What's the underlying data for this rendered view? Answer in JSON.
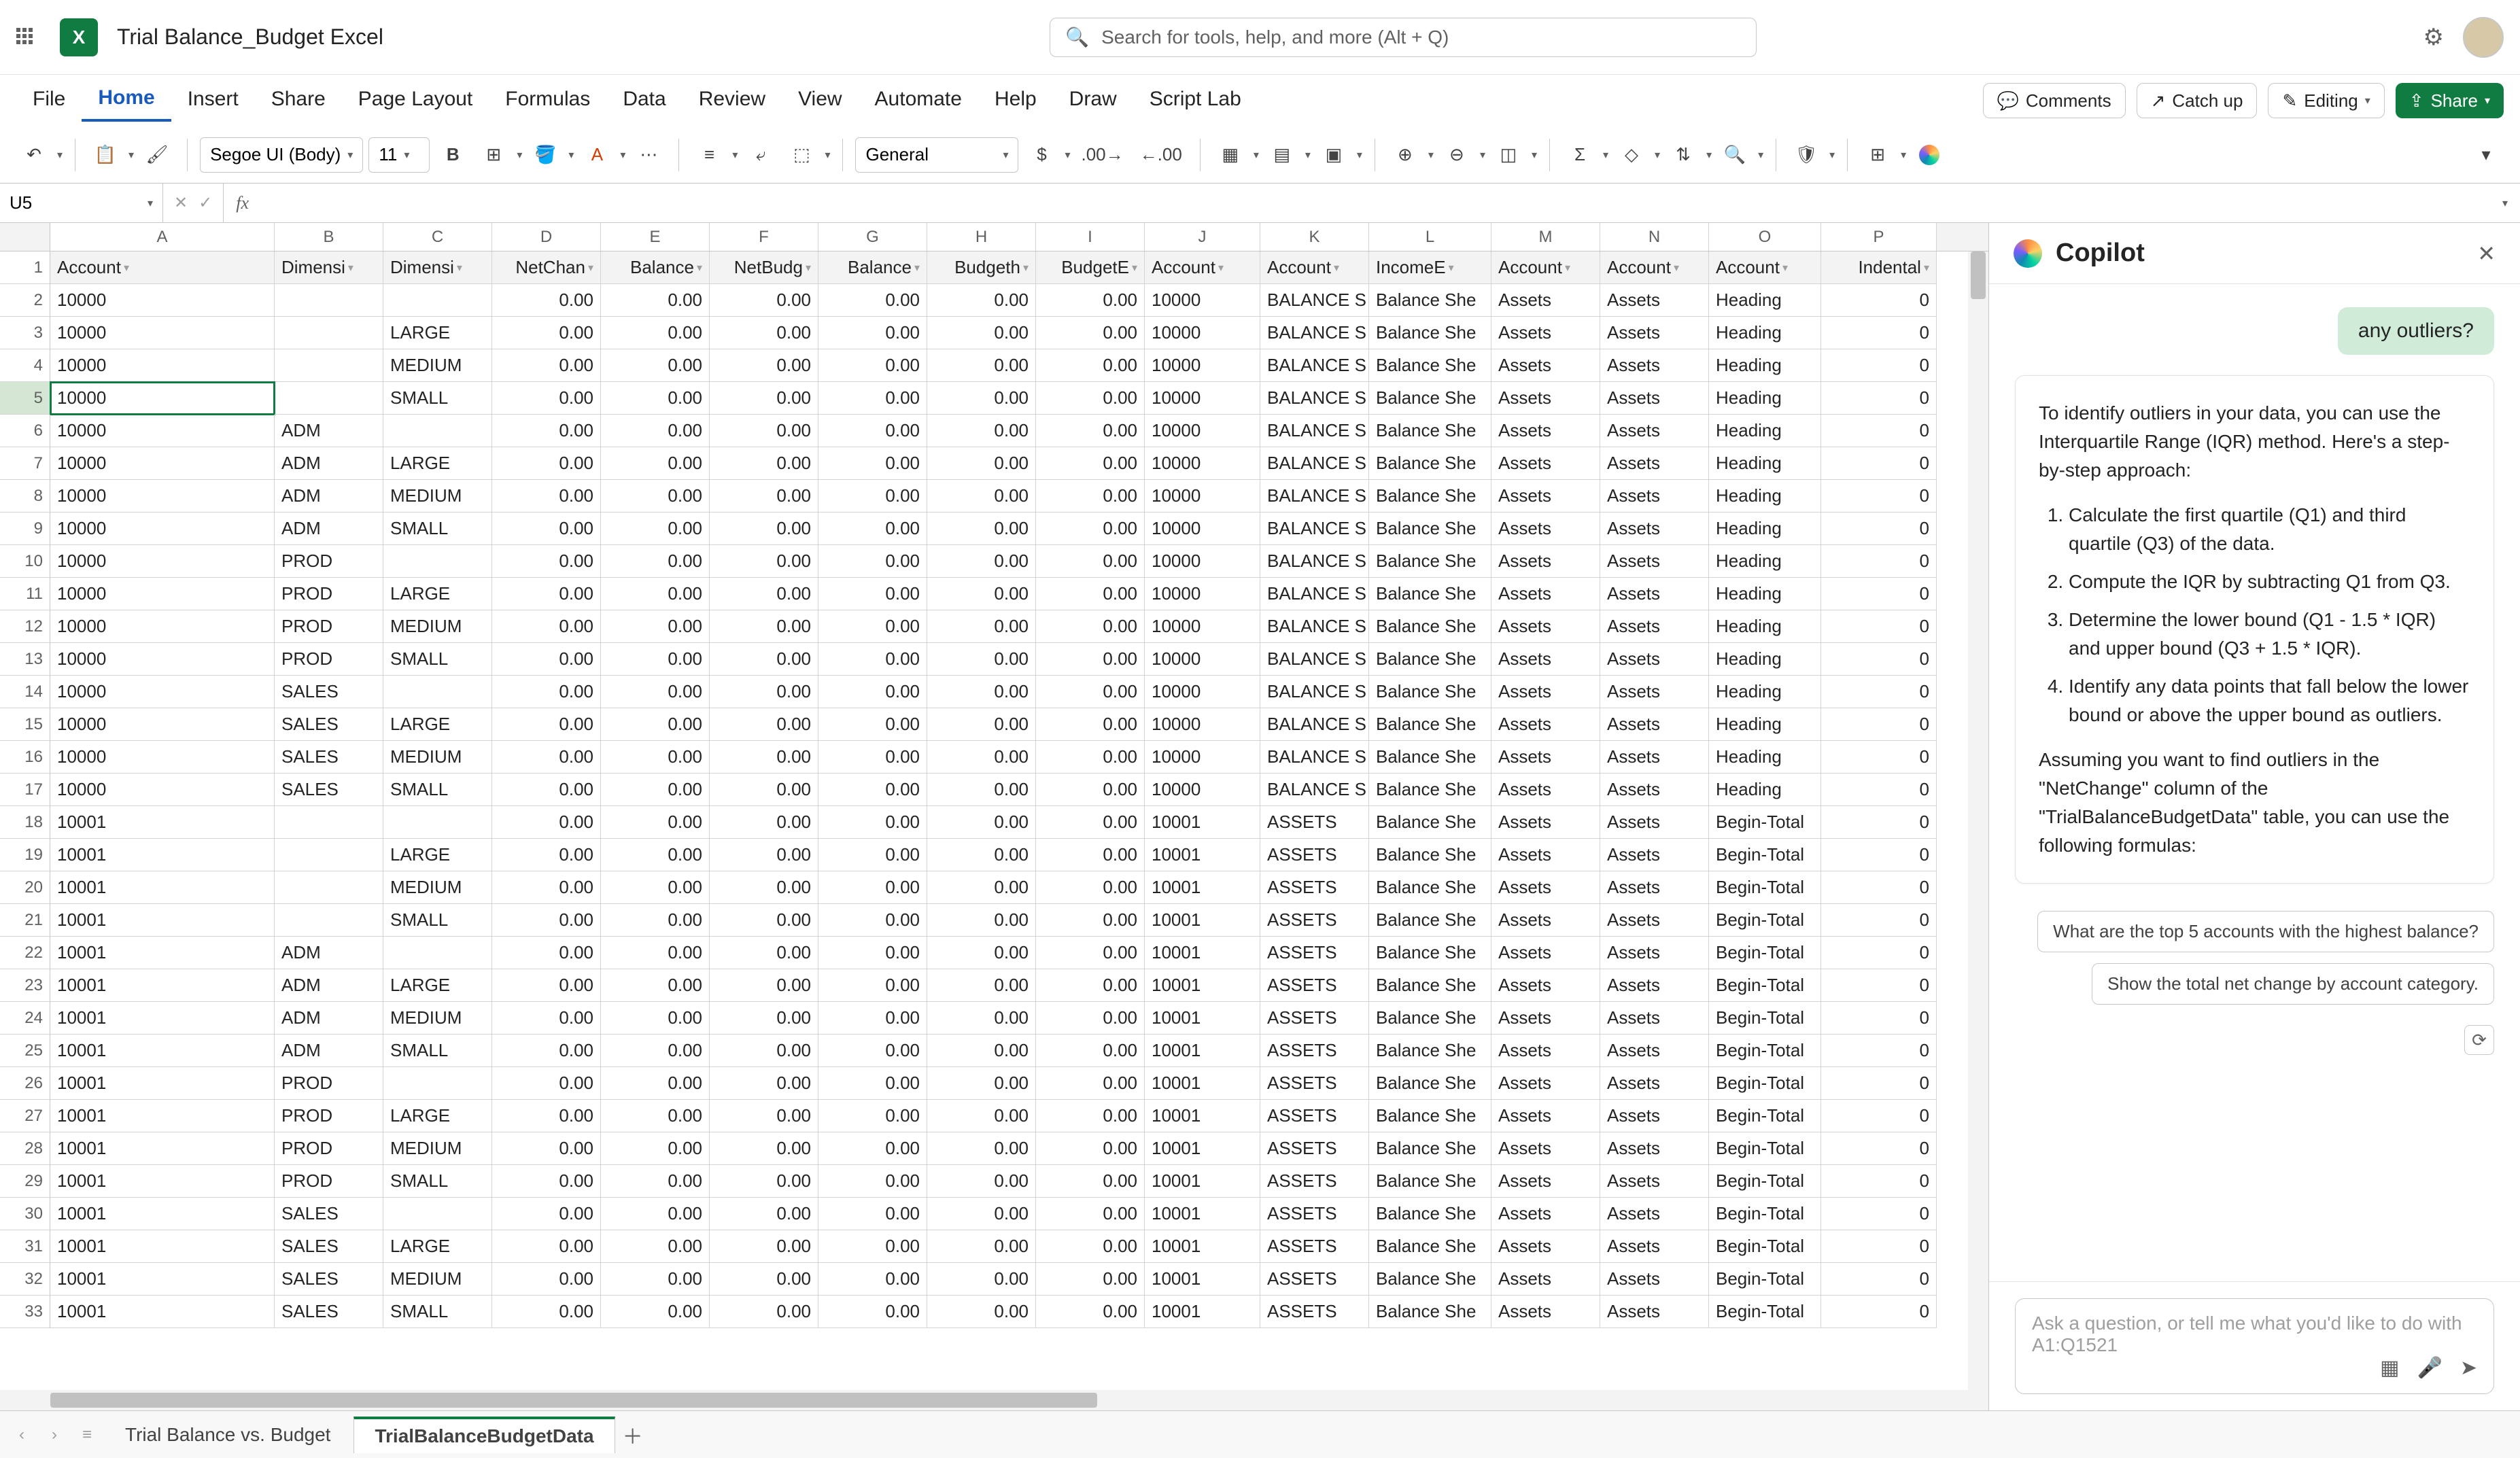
{
  "docTitle": "Trial Balance_Budget Excel",
  "searchPlaceholder": "Search for tools, help, and more (Alt + Q)",
  "menu": [
    "File",
    "Home",
    "Insert",
    "Share",
    "Page Layout",
    "Formulas",
    "Data",
    "Review",
    "View",
    "Automate",
    "Help",
    "Draw",
    "Script Lab"
  ],
  "menuActive": "Home",
  "pills": {
    "comments": "Comments",
    "catchup": "Catch up",
    "editing": "Editing",
    "share": "Share"
  },
  "fontName": "Segoe UI (Body)",
  "fontSize": "11",
  "numberFormat": "General",
  "nameBox": "U5",
  "cols": [
    "A",
    "B",
    "C",
    "D",
    "E",
    "F",
    "G",
    "H",
    "I",
    "J",
    "K",
    "L",
    "M",
    "N",
    "O",
    "P"
  ],
  "colWidths": [
    "cw-A",
    "cw-B",
    "cw-C",
    "cw-D",
    "cw-E",
    "cw-F",
    "cw-G",
    "cw-H",
    "cw-I",
    "cw-J",
    "cw-K",
    "cw-L",
    "cw-M",
    "cw-N",
    "cw-O",
    "cw-P"
  ],
  "headerRow": [
    "Account",
    "Dimensi",
    "Dimensi",
    "NetChan",
    "Balance",
    "NetBudg",
    "Balance",
    "Budgeth",
    "BudgetE",
    "Account",
    "Account",
    "IncomeE",
    "Account",
    "Account",
    "Account",
    "Indental"
  ],
  "rows": [
    [
      "10000",
      "",
      "",
      "0.00",
      "0.00",
      "0.00",
      "0.00",
      "0.00",
      "0.00",
      "10000",
      "BALANCE S",
      "Balance She",
      "Assets",
      "Assets",
      "Heading",
      "0"
    ],
    [
      "10000",
      "",
      "LARGE",
      "0.00",
      "0.00",
      "0.00",
      "0.00",
      "0.00",
      "0.00",
      "10000",
      "BALANCE S",
      "Balance She",
      "Assets",
      "Assets",
      "Heading",
      "0"
    ],
    [
      "10000",
      "",
      "MEDIUM",
      "0.00",
      "0.00",
      "0.00",
      "0.00",
      "0.00",
      "0.00",
      "10000",
      "BALANCE S",
      "Balance She",
      "Assets",
      "Assets",
      "Heading",
      "0"
    ],
    [
      "10000",
      "",
      "SMALL",
      "0.00",
      "0.00",
      "0.00",
      "0.00",
      "0.00",
      "0.00",
      "10000",
      "BALANCE S",
      "Balance She",
      "Assets",
      "Assets",
      "Heading",
      "0"
    ],
    [
      "10000",
      "ADM",
      "",
      "0.00",
      "0.00",
      "0.00",
      "0.00",
      "0.00",
      "0.00",
      "10000",
      "BALANCE S",
      "Balance She",
      "Assets",
      "Assets",
      "Heading",
      "0"
    ],
    [
      "10000",
      "ADM",
      "LARGE",
      "0.00",
      "0.00",
      "0.00",
      "0.00",
      "0.00",
      "0.00",
      "10000",
      "BALANCE S",
      "Balance She",
      "Assets",
      "Assets",
      "Heading",
      "0"
    ],
    [
      "10000",
      "ADM",
      "MEDIUM",
      "0.00",
      "0.00",
      "0.00",
      "0.00",
      "0.00",
      "0.00",
      "10000",
      "BALANCE S",
      "Balance She",
      "Assets",
      "Assets",
      "Heading",
      "0"
    ],
    [
      "10000",
      "ADM",
      "SMALL",
      "0.00",
      "0.00",
      "0.00",
      "0.00",
      "0.00",
      "0.00",
      "10000",
      "BALANCE S",
      "Balance She",
      "Assets",
      "Assets",
      "Heading",
      "0"
    ],
    [
      "10000",
      "PROD",
      "",
      "0.00",
      "0.00",
      "0.00",
      "0.00",
      "0.00",
      "0.00",
      "10000",
      "BALANCE S",
      "Balance She",
      "Assets",
      "Assets",
      "Heading",
      "0"
    ],
    [
      "10000",
      "PROD",
      "LARGE",
      "0.00",
      "0.00",
      "0.00",
      "0.00",
      "0.00",
      "0.00",
      "10000",
      "BALANCE S",
      "Balance She",
      "Assets",
      "Assets",
      "Heading",
      "0"
    ],
    [
      "10000",
      "PROD",
      "MEDIUM",
      "0.00",
      "0.00",
      "0.00",
      "0.00",
      "0.00",
      "0.00",
      "10000",
      "BALANCE S",
      "Balance She",
      "Assets",
      "Assets",
      "Heading",
      "0"
    ],
    [
      "10000",
      "PROD",
      "SMALL",
      "0.00",
      "0.00",
      "0.00",
      "0.00",
      "0.00",
      "0.00",
      "10000",
      "BALANCE S",
      "Balance She",
      "Assets",
      "Assets",
      "Heading",
      "0"
    ],
    [
      "10000",
      "SALES",
      "",
      "0.00",
      "0.00",
      "0.00",
      "0.00",
      "0.00",
      "0.00",
      "10000",
      "BALANCE S",
      "Balance She",
      "Assets",
      "Assets",
      "Heading",
      "0"
    ],
    [
      "10000",
      "SALES",
      "LARGE",
      "0.00",
      "0.00",
      "0.00",
      "0.00",
      "0.00",
      "0.00",
      "10000",
      "BALANCE S",
      "Balance She",
      "Assets",
      "Assets",
      "Heading",
      "0"
    ],
    [
      "10000",
      "SALES",
      "MEDIUM",
      "0.00",
      "0.00",
      "0.00",
      "0.00",
      "0.00",
      "0.00",
      "10000",
      "BALANCE S",
      "Balance She",
      "Assets",
      "Assets",
      "Heading",
      "0"
    ],
    [
      "10000",
      "SALES",
      "SMALL",
      "0.00",
      "0.00",
      "0.00",
      "0.00",
      "0.00",
      "0.00",
      "10000",
      "BALANCE S",
      "Balance She",
      "Assets",
      "Assets",
      "Heading",
      "0"
    ],
    [
      "10001",
      "",
      "",
      "0.00",
      "0.00",
      "0.00",
      "0.00",
      "0.00",
      "0.00",
      "10001",
      "ASSETS",
      "Balance She",
      "Assets",
      "Assets",
      "Begin-Total",
      "0"
    ],
    [
      "10001",
      "",
      "LARGE",
      "0.00",
      "0.00",
      "0.00",
      "0.00",
      "0.00",
      "0.00",
      "10001",
      "ASSETS",
      "Balance She",
      "Assets",
      "Assets",
      "Begin-Total",
      "0"
    ],
    [
      "10001",
      "",
      "MEDIUM",
      "0.00",
      "0.00",
      "0.00",
      "0.00",
      "0.00",
      "0.00",
      "10001",
      "ASSETS",
      "Balance She",
      "Assets",
      "Assets",
      "Begin-Total",
      "0"
    ],
    [
      "10001",
      "",
      "SMALL",
      "0.00",
      "0.00",
      "0.00",
      "0.00",
      "0.00",
      "0.00",
      "10001",
      "ASSETS",
      "Balance She",
      "Assets",
      "Assets",
      "Begin-Total",
      "0"
    ],
    [
      "10001",
      "ADM",
      "",
      "0.00",
      "0.00",
      "0.00",
      "0.00",
      "0.00",
      "0.00",
      "10001",
      "ASSETS",
      "Balance She",
      "Assets",
      "Assets",
      "Begin-Total",
      "0"
    ],
    [
      "10001",
      "ADM",
      "LARGE",
      "0.00",
      "0.00",
      "0.00",
      "0.00",
      "0.00",
      "0.00",
      "10001",
      "ASSETS",
      "Balance She",
      "Assets",
      "Assets",
      "Begin-Total",
      "0"
    ],
    [
      "10001",
      "ADM",
      "MEDIUM",
      "0.00",
      "0.00",
      "0.00",
      "0.00",
      "0.00",
      "0.00",
      "10001",
      "ASSETS",
      "Balance She",
      "Assets",
      "Assets",
      "Begin-Total",
      "0"
    ],
    [
      "10001",
      "ADM",
      "SMALL",
      "0.00",
      "0.00",
      "0.00",
      "0.00",
      "0.00",
      "0.00",
      "10001",
      "ASSETS",
      "Balance She",
      "Assets",
      "Assets",
      "Begin-Total",
      "0"
    ],
    [
      "10001",
      "PROD",
      "",
      "0.00",
      "0.00",
      "0.00",
      "0.00",
      "0.00",
      "0.00",
      "10001",
      "ASSETS",
      "Balance She",
      "Assets",
      "Assets",
      "Begin-Total",
      "0"
    ],
    [
      "10001",
      "PROD",
      "LARGE",
      "0.00",
      "0.00",
      "0.00",
      "0.00",
      "0.00",
      "0.00",
      "10001",
      "ASSETS",
      "Balance She",
      "Assets",
      "Assets",
      "Begin-Total",
      "0"
    ],
    [
      "10001",
      "PROD",
      "MEDIUM",
      "0.00",
      "0.00",
      "0.00",
      "0.00",
      "0.00",
      "0.00",
      "10001",
      "ASSETS",
      "Balance She",
      "Assets",
      "Assets",
      "Begin-Total",
      "0"
    ],
    [
      "10001",
      "PROD",
      "SMALL",
      "0.00",
      "0.00",
      "0.00",
      "0.00",
      "0.00",
      "0.00",
      "10001",
      "ASSETS",
      "Balance She",
      "Assets",
      "Assets",
      "Begin-Total",
      "0"
    ],
    [
      "10001",
      "SALES",
      "",
      "0.00",
      "0.00",
      "0.00",
      "0.00",
      "0.00",
      "0.00",
      "10001",
      "ASSETS",
      "Balance She",
      "Assets",
      "Assets",
      "Begin-Total",
      "0"
    ],
    [
      "10001",
      "SALES",
      "LARGE",
      "0.00",
      "0.00",
      "0.00",
      "0.00",
      "0.00",
      "0.00",
      "10001",
      "ASSETS",
      "Balance She",
      "Assets",
      "Assets",
      "Begin-Total",
      "0"
    ],
    [
      "10001",
      "SALES",
      "MEDIUM",
      "0.00",
      "0.00",
      "0.00",
      "0.00",
      "0.00",
      "0.00",
      "10001",
      "ASSETS",
      "Balance She",
      "Assets",
      "Assets",
      "Begin-Total",
      "0"
    ],
    [
      "10001",
      "SALES",
      "SMALL",
      "0.00",
      "0.00",
      "0.00",
      "0.00",
      "0.00",
      "0.00",
      "10001",
      "ASSETS",
      "Balance She",
      "Assets",
      "Assets",
      "Begin-Total",
      "0"
    ]
  ],
  "rightAlignCols": [
    3,
    4,
    5,
    6,
    7,
    8,
    15
  ],
  "selectedRow": 5,
  "copilot": {
    "title": "Copilot",
    "userMsg": "any outliers?",
    "intro": "To identify outliers in your data, you can use the Interquartile Range (IQR) method. Here's a step-by-step approach:",
    "steps": [
      "Calculate the first quartile (Q1) and third quartile (Q3) of the data.",
      "Compute the IQR by subtracting Q1 from Q3.",
      "Determine the lower bound (Q1 - 1.5 * IQR) and upper bound (Q3 + 1.5 * IQR).",
      "Identify any data points that fall below the lower bound or above the upper bound as outliers."
    ],
    "outro": "Assuming you want to find outliers in the \"NetChange\" column of the \"TrialBalanceBudgetData\" table, you can use the following formulas:",
    "suggestions": [
      "What are the top 5 accounts with the highest balance?",
      "Show the total net change by account category."
    ],
    "askPlaceholder": "Ask a question, or tell me what you'd like to do with A1:Q1521"
  },
  "sheets": [
    "Trial Balance vs. Budget",
    "TrialBalanceBudgetData"
  ],
  "activeSheet": "TrialBalanceBudgetData"
}
